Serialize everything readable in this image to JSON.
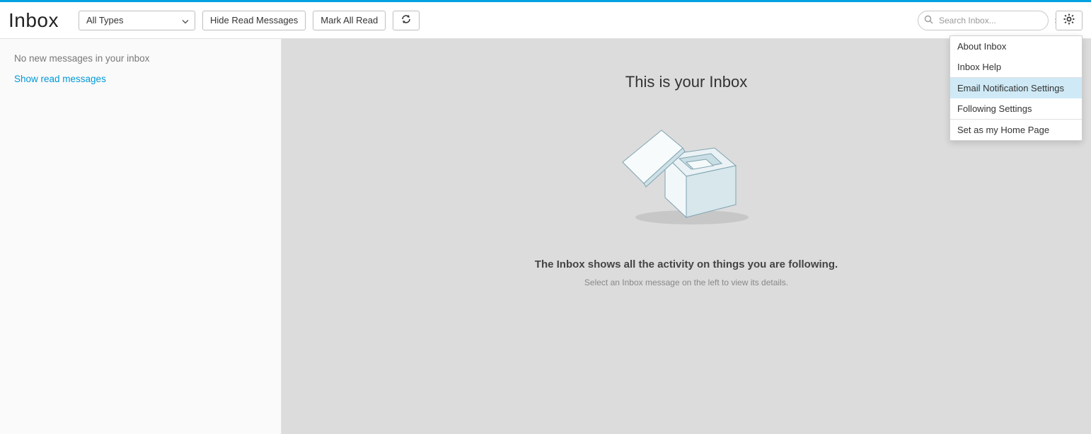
{
  "header": {
    "title": "Inbox",
    "type_filter": "All Types",
    "hide_read": "Hide Read Messages",
    "mark_all_read": "Mark All Read",
    "search_placeholder": "Search Inbox..."
  },
  "sidebar": {
    "empty_message": "No new messages in your inbox",
    "show_read_link": "Show read messages"
  },
  "main": {
    "headline": "This is your Inbox",
    "sub1": "The Inbox shows all the activity on things you are following.",
    "sub2": "Select an Inbox message on the left to view its details."
  },
  "menu": {
    "items": [
      "About Inbox",
      "Inbox Help",
      "Email Notification Settings",
      "Following Settings",
      "Set as my Home Page"
    ],
    "highlighted_index": 2
  }
}
